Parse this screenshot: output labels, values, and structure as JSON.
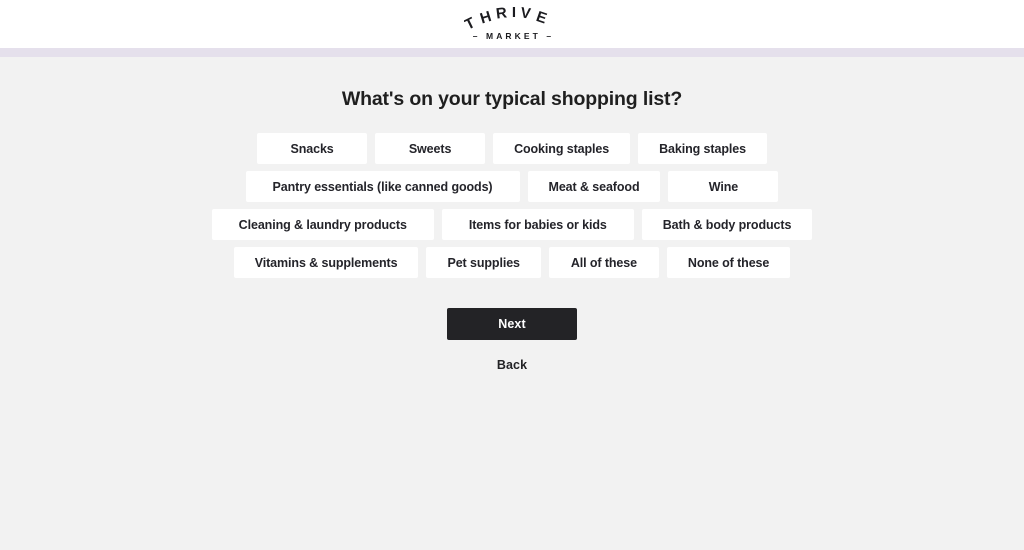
{
  "brand": {
    "logo_primary": "THRIVE",
    "logo_secondary": "– MARKET –",
    "logo_letters": [
      "T",
      "H",
      "R",
      "I",
      "V",
      "E"
    ],
    "logo_icon": "thrive-market-logo"
  },
  "progress": {
    "color": "#e5e0ec",
    "track_color": "#e5e0ec"
  },
  "main": {
    "title": "What's on your typical shopping list?",
    "options": [
      {
        "label": "Snacks",
        "selected": false
      },
      {
        "label": "Sweets",
        "selected": false
      },
      {
        "label": "Cooking staples",
        "selected": false
      },
      {
        "label": "Baking staples",
        "selected": false
      },
      {
        "label": "Pantry essentials (like canned goods)",
        "selected": false
      },
      {
        "label": "Meat & seafood",
        "selected": false
      },
      {
        "label": "Wine",
        "selected": false
      },
      {
        "label": "Cleaning & laundry products",
        "selected": false
      },
      {
        "label": "Items for babies or kids",
        "selected": false
      },
      {
        "label": "Bath & body products",
        "selected": false
      },
      {
        "label": "Vitamins & supplements",
        "selected": false
      },
      {
        "label": "Pet supplies",
        "selected": false
      },
      {
        "label": "All of these",
        "selected": false
      },
      {
        "label": "None of these",
        "selected": false
      }
    ]
  },
  "actions": {
    "next_label": "Next",
    "back_label": "Back",
    "next_color": "#232326"
  },
  "colors": {
    "page_background": "#f2f2f2",
    "header_background": "#ffffff",
    "chip_background": "#ffffff",
    "text": "#24242a",
    "accent_bar": "#e5e0ec"
  }
}
